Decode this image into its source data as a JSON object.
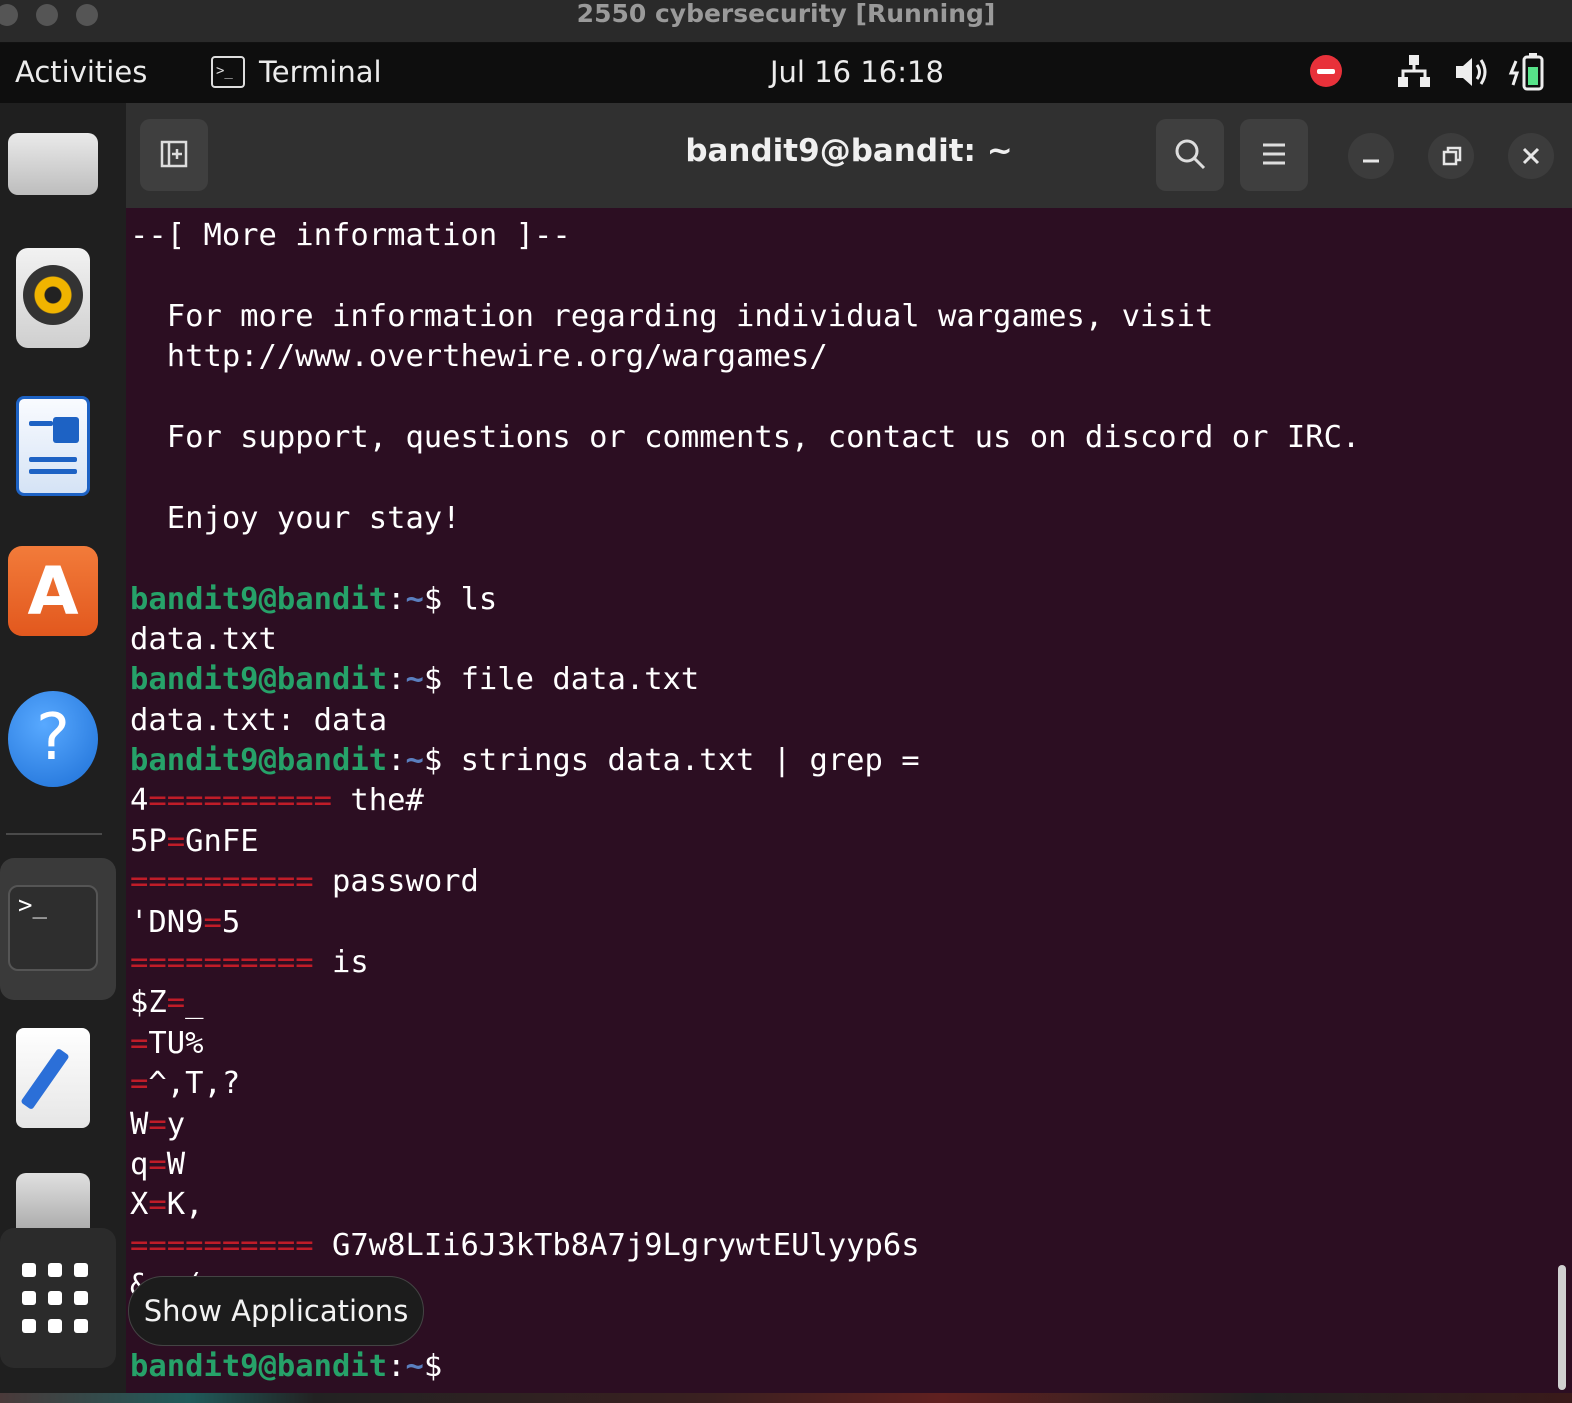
{
  "vm_window": {
    "title": "2550 cybersecurity [Running]"
  },
  "top_panel": {
    "activities": "Activities",
    "app_name": "Terminal",
    "clock": "Jul 16  16:18"
  },
  "dock": {
    "apps": [
      "files-icon",
      "rhythmbox-icon",
      "libreoffice-writer-icon",
      "app-center-icon",
      "help-icon",
      "terminal-icon",
      "text-editor-icon",
      "disk-icon",
      "show-applications-icon"
    ],
    "tooltip": "Show Applications"
  },
  "terminal": {
    "title": "bandit9@bandit: ~",
    "prompt_user": "bandit9@bandit",
    "prompt_sep": ":",
    "prompt_path": "~",
    "prompt_dollar": "$",
    "motd": {
      "heading": "--[ More information ]--",
      "line1": "  For more information regarding individual wargames, visit",
      "line2": "  http://www.overthewire.org/wargames/",
      "line3": "  For support, questions or comments, contact us on discord or IRC.",
      "line4": "  Enjoy your stay!"
    },
    "cmd1": " ls",
    "out1": "data.txt",
    "cmd2": " file data.txt",
    "out2": "data.txt: data",
    "cmd3": " strings data.txt | grep =",
    "grep_lines": [
      {
        "pre": "4",
        "eq": "==========",
        "post": " the#"
      },
      {
        "pre": "5P",
        "eq": "=",
        "post": "GnFE"
      },
      {
        "pre": "",
        "eq": "==========",
        "post": " password"
      },
      {
        "pre": "'DN9",
        "eq": "=",
        "post": "5"
      },
      {
        "pre": "",
        "eq": "==========",
        "post": " is"
      },
      {
        "pre": "$Z",
        "eq": "=",
        "post": "_"
      },
      {
        "pre": "",
        "eq": "=",
        "post": "TU%"
      },
      {
        "pre": "",
        "eq": "=",
        "post": "^,T,?"
      },
      {
        "pre": "W",
        "eq": "=",
        "post": "y"
      },
      {
        "pre": "q",
        "eq": "=",
        "post": "W"
      },
      {
        "pre": "X",
        "eq": "=",
        "post": "K,"
      },
      {
        "pre": "",
        "eq": "==========",
        "post": " G7w8LIi6J3kTb8A7j9LgrywtEUlyyp6s"
      }
    ],
    "partial_line": "&c_("
  },
  "colors": {
    "terminal_bg": "#2c0e22",
    "prompt_green": "#26a269",
    "highlight_red": "#c01c28"
  }
}
